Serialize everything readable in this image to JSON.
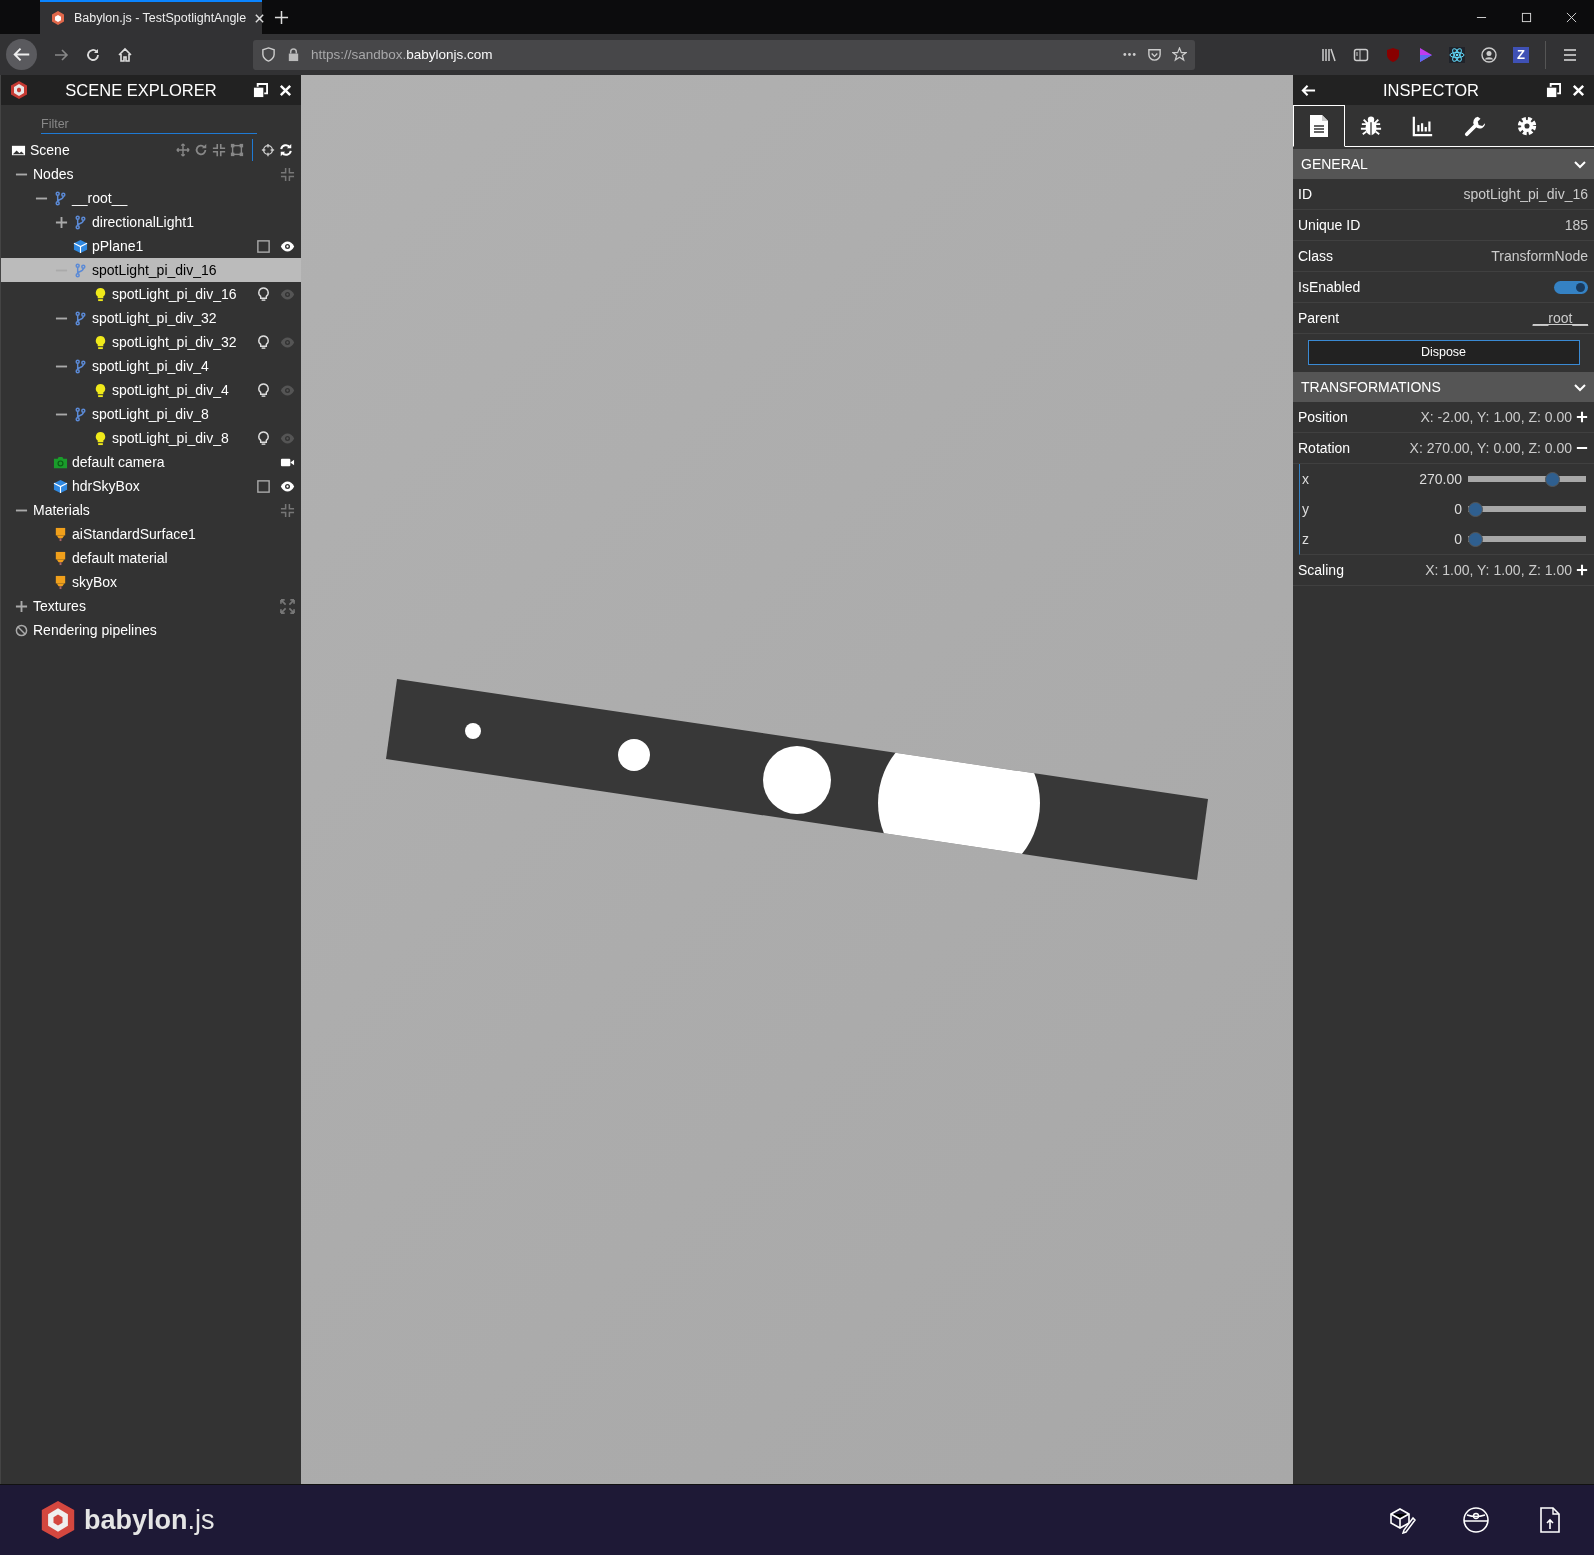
{
  "browser": {
    "tab": {
      "title": "Babylon.js - TestSpotlightAngle",
      "selected": true
    },
    "url": {
      "prefix": "https://sandbox.",
      "domain": "babylonjs.com"
    },
    "extension_letter": "Z"
  },
  "scene_explorer": {
    "title": "SCENE EXPLORER",
    "filter": {
      "placeholder": "Filter"
    },
    "scene": {
      "label": "Scene"
    },
    "categories": [
      {
        "label": "Nodes",
        "kind": "category",
        "expanded": true,
        "children": [
          {
            "label": "__root__",
            "kind": "transform",
            "expanded": true,
            "selected": false,
            "children": [
              {
                "label": "directionalLight1",
                "kind": "transform",
                "expanded": false,
                "selected": false
              },
              {
                "label": "pPlane1",
                "kind": "mesh",
                "selected": false,
                "checked": false,
                "visible": true
              },
              {
                "label": "spotLight_pi_div_16",
                "kind": "transform",
                "expanded": true,
                "selected": true,
                "children": [
                  {
                    "label": "spotLight_pi_div_16",
                    "kind": "light",
                    "selected": false,
                    "visible": false
                  }
                ]
              },
              {
                "label": "spotLight_pi_div_32",
                "kind": "transform",
                "expanded": true,
                "selected": false,
                "children": [
                  {
                    "label": "spotLight_pi_div_32",
                    "kind": "light",
                    "selected": false,
                    "visible": false
                  }
                ]
              },
              {
                "label": "spotLight_pi_div_4",
                "kind": "transform",
                "expanded": true,
                "selected": false,
                "children": [
                  {
                    "label": "spotLight_pi_div_4",
                    "kind": "light",
                    "selected": false,
                    "visible": false
                  }
                ]
              },
              {
                "label": "spotLight_pi_div_8",
                "kind": "transform",
                "expanded": true,
                "selected": false,
                "children": [
                  {
                    "label": "spotLight_pi_div_8",
                    "kind": "light",
                    "selected": false,
                    "visible": false
                  }
                ]
              }
            ]
          },
          {
            "label": "default camera",
            "kind": "camera",
            "selected": false
          },
          {
            "label": "hdrSkyBox",
            "kind": "mesh",
            "selected": false,
            "checked": false,
            "visible": true
          }
        ]
      },
      {
        "label": "Materials",
        "kind": "category",
        "expanded": true,
        "children": [
          {
            "label": "aiStandardSurface1",
            "kind": "material",
            "selected": false
          },
          {
            "label": "default material",
            "kind": "material",
            "selected": false
          },
          {
            "label": "skyBox",
            "kind": "material",
            "selected": false
          }
        ]
      },
      {
        "label": "Textures",
        "kind": "category",
        "expanded": false
      },
      {
        "label": "Rendering pipelines",
        "kind": "empty"
      }
    ]
  },
  "inspector": {
    "title": "INSPECTOR",
    "tabs": [
      {
        "kind": "properties",
        "selected": true
      },
      {
        "kind": "debug",
        "selected": false
      },
      {
        "kind": "statistics",
        "selected": false
      },
      {
        "kind": "tools",
        "selected": false
      },
      {
        "kind": "settings",
        "selected": false
      }
    ],
    "sections": [
      {
        "title": "GENERAL",
        "expanded": true,
        "rows": [
          {
            "kind": "text",
            "label": "ID",
            "value": "spotLight_pi_div_16"
          },
          {
            "kind": "text",
            "label": "Unique ID",
            "value": "185"
          },
          {
            "kind": "text",
            "label": "Class",
            "value": "TransformNode"
          },
          {
            "kind": "toggle",
            "label": "IsEnabled",
            "on": true
          },
          {
            "kind": "link",
            "label": "Parent",
            "value": "__root__"
          },
          {
            "kind": "button",
            "label": "Dispose"
          }
        ]
      },
      {
        "title": "TRANSFORMATIONS",
        "expanded": true,
        "rows": [
          {
            "kind": "vector",
            "label": "Position",
            "value": "X: -2.00, Y: 1.00, Z: 0.00",
            "expanded": false
          },
          {
            "kind": "vector",
            "label": "Rotation",
            "value": "X: 270.00, Y: 0.00, Z: 0.00",
            "expanded": true,
            "components": [
              {
                "label": "x",
                "value": "270.00",
                "level": 0.75
              },
              {
                "label": "y",
                "value": "0",
                "level": 0
              },
              {
                "label": "z",
                "value": "0",
                "level": 0
              }
            ]
          },
          {
            "kind": "vector",
            "label": "Scaling",
            "value": "X: 1.00, Y: 1.00, Z: 1.00",
            "expanded": false
          }
        ]
      }
    ]
  },
  "footer": {
    "brand": "babylon",
    "brand_suffix": ".js"
  }
}
